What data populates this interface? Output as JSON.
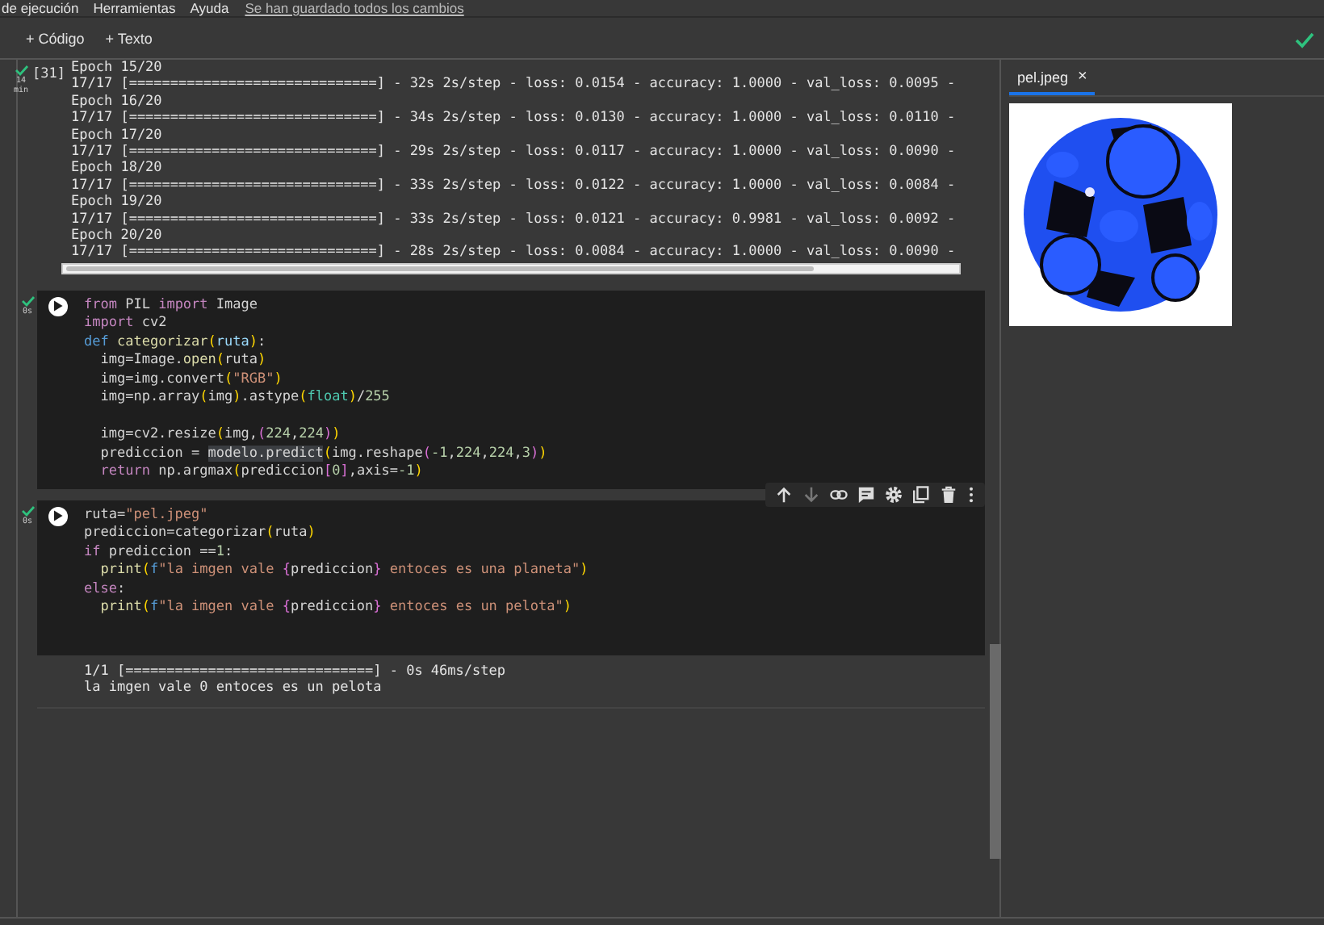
{
  "menu": {
    "items": [
      "de ejecución",
      "Herramientas",
      "Ayuda"
    ],
    "save_status": "Se han guardado todos los cambios"
  },
  "toolbar": {
    "buttons": [
      "+ Código",
      "+ Texto"
    ]
  },
  "cells": [
    {
      "kind": "output",
      "succeeded": true,
      "duration": "14",
      "duration_unit": "min",
      "exec_count": "[31]",
      "toolbar": false,
      "output": [
        "Epoch 15/20",
        "17/17 [==============================] - 32s 2s/step - loss: 0.0154 - accuracy: 1.0000 - val_loss: 0.0095 -",
        "Epoch 16/20",
        "17/17 [==============================] - 34s 2s/step - loss: 0.0130 - accuracy: 1.0000 - val_loss: 0.0110 -",
        "Epoch 17/20",
        "17/17 [==============================] - 29s 2s/step - loss: 0.0117 - accuracy: 1.0000 - val_loss: 0.0090 -",
        "Epoch 18/20",
        "17/17 [==============================] - 33s 2s/step - loss: 0.0122 - accuracy: 1.0000 - val_loss: 0.0084 -",
        "Epoch 19/20",
        "17/17 [==============================] - 33s 2s/step - loss: 0.0121 - accuracy: 0.9981 - val_loss: 0.0092 -",
        "Epoch 20/20",
        "17/17 [==============================] - 28s 2s/step - loss: 0.0084 - accuracy: 1.0000 - val_loss: 0.0090 -"
      ]
    },
    {
      "kind": "code",
      "succeeded": true,
      "duration": "0s",
      "toolbar": false,
      "code": [
        [
          [
            {
              "kind": "kw",
              "text": "from"
            },
            {
              "kind": "plain",
              "text": " PIL "
            },
            {
              "kind": "kw",
              "text": "import"
            },
            {
              "kind": "plain",
              "text": " Image"
            }
          ],
          [
            {
              "kind": "kw",
              "text": "import"
            },
            {
              "kind": "plain",
              "text": " cv2"
            }
          ],
          [
            {
              "kind": "def",
              "text": "def "
            },
            {
              "kind": "fn",
              "text": "categorizar"
            },
            {
              "kind": "br",
              "text": "("
            },
            {
              "kind": "param",
              "text": "ruta"
            },
            {
              "kind": "br",
              "text": ")"
            },
            {
              "kind": "plain",
              "text": ":"
            }
          ],
          [
            {
              "kind": "plain",
              "text": "  img=Image."
            },
            {
              "kind": "fn",
              "text": "open"
            },
            {
              "kind": "br",
              "text": "("
            },
            {
              "kind": "plain",
              "text": "ruta"
            },
            {
              "kind": "br",
              "text": ")"
            }
          ],
          [
            {
              "kind": "plain",
              "text": "  img=img.convert"
            },
            {
              "kind": "br",
              "text": "("
            },
            {
              "kind": "str",
              "text": "\"RGB\""
            },
            {
              "kind": "br",
              "text": ")"
            }
          ],
          [
            {
              "kind": "plain",
              "text": "  img=np.array"
            },
            {
              "kind": "br",
              "text": "("
            },
            {
              "kind": "plain",
              "text": "img"
            },
            {
              "kind": "br",
              "text": ")"
            },
            {
              "kind": "plain",
              "text": ".astype"
            },
            {
              "kind": "br",
              "text": "("
            },
            {
              "kind": "type",
              "text": "float"
            },
            {
              "kind": "br",
              "text": ")"
            },
            {
              "kind": "plain",
              "text": "/"
            },
            {
              "kind": "num",
              "text": "255"
            }
          ]
        ],
        [
          [
            {
              "kind": "plain",
              "text": "  img=cv2.resize"
            },
            {
              "kind": "br",
              "text": "("
            },
            {
              "kind": "plain",
              "text": "img,"
            },
            {
              "kind": "br2",
              "text": "("
            },
            {
              "kind": "num",
              "text": "224"
            },
            {
              "kind": "plain",
              "text": ","
            },
            {
              "kind": "num",
              "text": "224"
            },
            {
              "kind": "br2",
              "text": ")"
            },
            {
              "kind": "br",
              "text": ")"
            }
          ],
          [
            {
              "kind": "plain",
              "text": "  prediccion = "
            },
            {
              "kind": "sel",
              "text": "modelo.predict"
            },
            {
              "kind": "br",
              "text": "("
            },
            {
              "kind": "plain",
              "text": "img.reshape"
            },
            {
              "kind": "br2",
              "text": "("
            },
            {
              "kind": "num",
              "text": "-1"
            },
            {
              "kind": "plain",
              "text": ","
            },
            {
              "kind": "num",
              "text": "224"
            },
            {
              "kind": "plain",
              "text": ","
            },
            {
              "kind": "num",
              "text": "224"
            },
            {
              "kind": "plain",
              "text": ","
            },
            {
              "kind": "num",
              "text": "3"
            },
            {
              "kind": "br2",
              "text": ")"
            },
            {
              "kind": "br",
              "text": ")"
            }
          ],
          [
            {
              "kind": "kw",
              "text": "  return"
            },
            {
              "kind": "plain",
              "text": " np.argmax"
            },
            {
              "kind": "br",
              "text": "("
            },
            {
              "kind": "plain",
              "text": "prediccion"
            },
            {
              "kind": "br2",
              "text": "["
            },
            {
              "kind": "num",
              "text": "0"
            },
            {
              "kind": "br2",
              "text": "]"
            },
            {
              "kind": "plain",
              "text": ",axis="
            },
            {
              "kind": "num",
              "text": "-1"
            },
            {
              "kind": "br",
              "text": ")"
            }
          ]
        ]
      ]
    },
    {
      "kind": "code",
      "succeeded": true,
      "duration": "0s",
      "toolbar": true,
      "code": [
        [
          [
            {
              "kind": "plain",
              "text": "ruta="
            },
            {
              "kind": "str",
              "text": "\"pel.jpeg\""
            }
          ],
          [
            {
              "kind": "plain",
              "text": "prediccion=categorizar"
            },
            {
              "kind": "br",
              "text": "("
            },
            {
              "kind": "plain",
              "text": "ruta"
            },
            {
              "kind": "br",
              "text": ")"
            }
          ],
          [
            {
              "kind": "kw",
              "text": "if"
            },
            {
              "kind": "plain",
              "text": " prediccion =="
            },
            {
              "kind": "num",
              "text": "1"
            },
            {
              "kind": "plain",
              "text": ":"
            }
          ],
          [
            {
              "kind": "fn",
              "text": "  print"
            },
            {
              "kind": "br",
              "text": "("
            },
            {
              "kind": "def",
              "text": "f"
            },
            {
              "kind": "str",
              "text": "\"la imgen vale "
            },
            {
              "kind": "br2",
              "text": "{"
            },
            {
              "kind": "plain",
              "text": "prediccion"
            },
            {
              "kind": "br2",
              "text": "}"
            },
            {
              "kind": "str",
              "text": " entoces es una planeta\""
            },
            {
              "kind": "br",
              "text": ")"
            }
          ],
          [
            {
              "kind": "kw",
              "text": "else"
            },
            {
              "kind": "plain",
              "text": ":"
            }
          ],
          [
            {
              "kind": "fn",
              "text": "  print"
            },
            {
              "kind": "br",
              "text": "("
            },
            {
              "kind": "def",
              "text": "f"
            },
            {
              "kind": "str",
              "text": "\"la imgen vale "
            },
            {
              "kind": "br2",
              "text": "{"
            },
            {
              "kind": "plain",
              "text": "prediccion"
            },
            {
              "kind": "br2",
              "text": "}"
            },
            {
              "kind": "str",
              "text": " entoces es un pelota\""
            },
            {
              "kind": "br",
              "text": ")"
            }
          ]
        ]
      ],
      "output": [
        "1/1 [==============================] - 0s 46ms/step",
        "la imgen vale 0 entoces es un pelota"
      ]
    }
  ],
  "side_panel": {
    "tabs": [
      {
        "label": "pel.jpeg",
        "close": "×",
        "selected": true
      }
    ]
  }
}
